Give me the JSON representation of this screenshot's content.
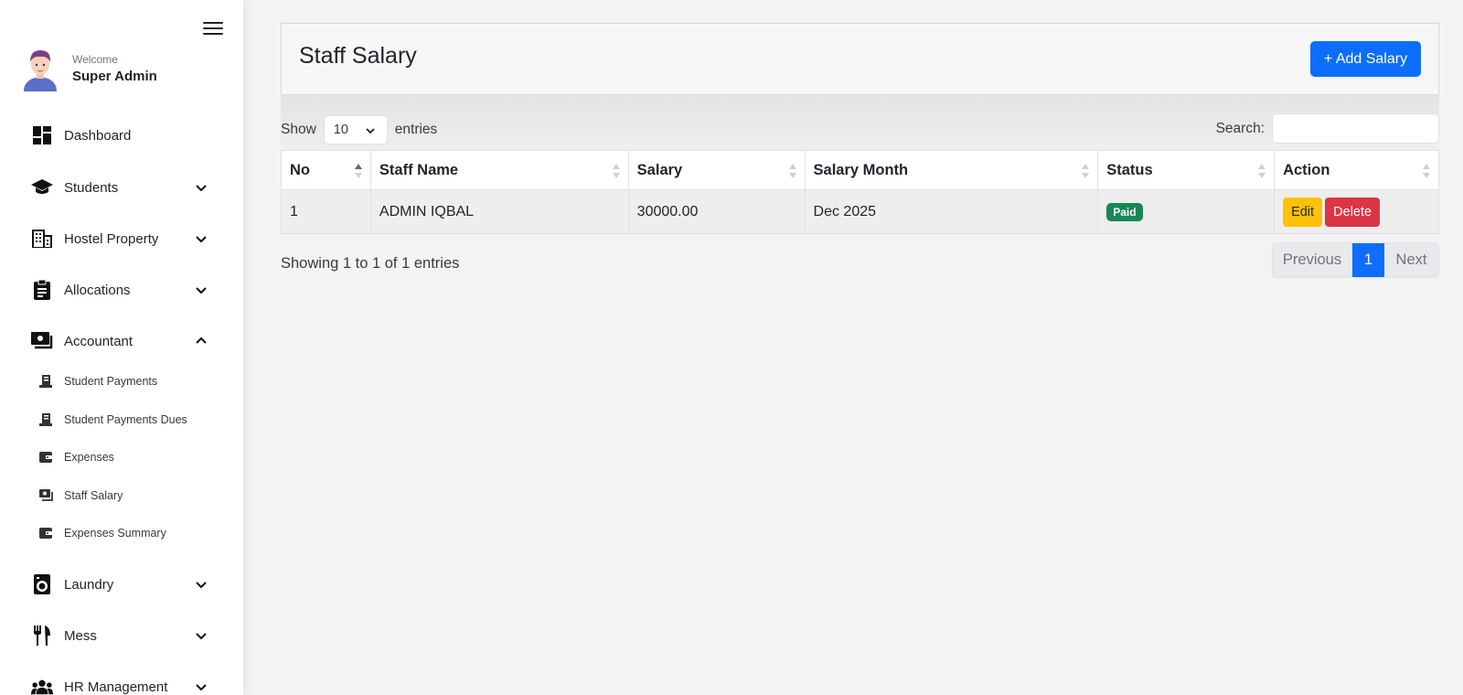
{
  "sidebar": {
    "welcome": "Welcome",
    "user_name": "Super Admin",
    "items": [
      {
        "label": "Dashboard",
        "icon": "dashboard-icon"
      },
      {
        "label": "Students",
        "icon": "graduation-cap-icon"
      },
      {
        "label": "Hostel Property",
        "icon": "building-icon"
      },
      {
        "label": "Allocations",
        "icon": "clipboard-icon"
      },
      {
        "label": "Accountant",
        "icon": "cash-icon"
      },
      {
        "label": "Laundry",
        "icon": "washing-machine-icon"
      },
      {
        "label": "Mess",
        "icon": "utensils-icon"
      },
      {
        "label": "HR Management",
        "icon": "users-icon"
      }
    ],
    "accountant_sub": [
      {
        "label": "Student Payments",
        "icon": "receipt-icon"
      },
      {
        "label": "Student Payments Dues",
        "icon": "receipt-icon"
      },
      {
        "label": "Expenses",
        "icon": "wallet-icon"
      },
      {
        "label": "Staff Salary",
        "icon": "cash-icon"
      },
      {
        "label": "Expenses Summary",
        "icon": "wallet-icon"
      }
    ]
  },
  "header": {
    "title": "Staff Salary",
    "add_button": "+ Add Salary"
  },
  "controls": {
    "show": "Show",
    "entries_count": "10",
    "entries": "entries",
    "search_label": "Search:",
    "search_value": ""
  },
  "table": {
    "columns": [
      "No",
      "Staff Name",
      "Salary",
      "Salary Month",
      "Status",
      "Action"
    ],
    "rows": [
      {
        "no": "1",
        "staff_name": "ADMIN IQBAL",
        "salary": "30000.00",
        "month": "Dec 2025",
        "status": "Paid",
        "edit": "Edit",
        "delete": "Delete"
      }
    ]
  },
  "footer": {
    "info": "Showing 1 to 1 of 1 entries",
    "previous": "Previous",
    "page": "1",
    "next": "Next"
  },
  "colors": {
    "primary": "#0d6efd",
    "success": "#198754",
    "warning": "#ffc107",
    "danger": "#dc3545"
  }
}
